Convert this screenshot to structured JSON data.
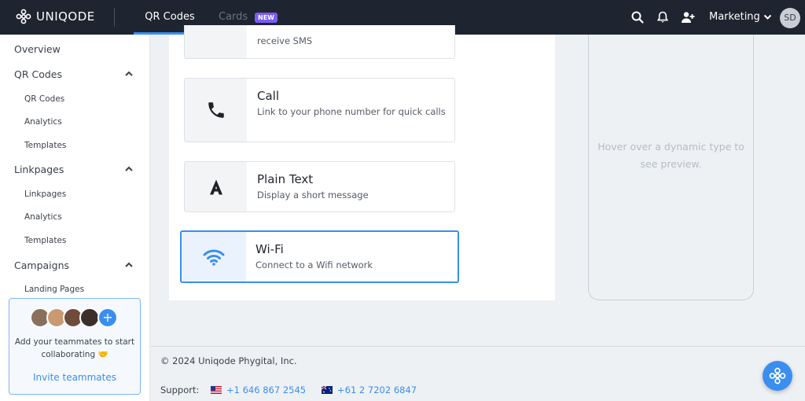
{
  "app": {
    "logo_text": "UNIQODE"
  },
  "topnav": {
    "tabs": [
      {
        "label": "QR Codes",
        "active": true
      },
      {
        "label": "Cards",
        "badge": "NEW"
      }
    ],
    "workspace": "Marketing",
    "avatar_initials": "SD"
  },
  "sidebar": {
    "sections": [
      {
        "label": "Overview"
      },
      {
        "label": "QR Codes",
        "expanded": true,
        "items": [
          "QR Codes",
          "Analytics",
          "Templates"
        ]
      },
      {
        "label": "Linkpages",
        "expanded": true,
        "items": [
          "Linkpages",
          "Analytics",
          "Templates"
        ]
      },
      {
        "label": "Campaigns",
        "expanded": true,
        "items": [
          "Landing Pages"
        ]
      }
    ],
    "invite": {
      "text": "Add your teammates to start collaborating 🤝",
      "link": "Invite teammates"
    }
  },
  "types": [
    {
      "title": "",
      "desc": "receive SMS",
      "icon": "sms-icon"
    },
    {
      "title": "Call",
      "desc": "Link to your phone number for quick calls",
      "icon": "phone-icon"
    },
    {
      "title": "Plain Text",
      "desc": "Display a short message",
      "icon": "text-a-icon"
    },
    {
      "title": "Wi-Fi",
      "desc": "Connect to a Wifi network",
      "icon": "wifi-icon",
      "selected": true
    }
  ],
  "preview": {
    "placeholder": "Hover over a dynamic type to see preview."
  },
  "footer": {
    "copyright": "© 2024 Uniqode Phygital, Inc.",
    "support_label": "Support:",
    "phones": [
      "+1 646 867 2545",
      "+61 2 7202 6847"
    ]
  },
  "colors": {
    "accent": "#3a8ef0",
    "topbar": "#1e2530",
    "badge": "#7b5cf5"
  }
}
